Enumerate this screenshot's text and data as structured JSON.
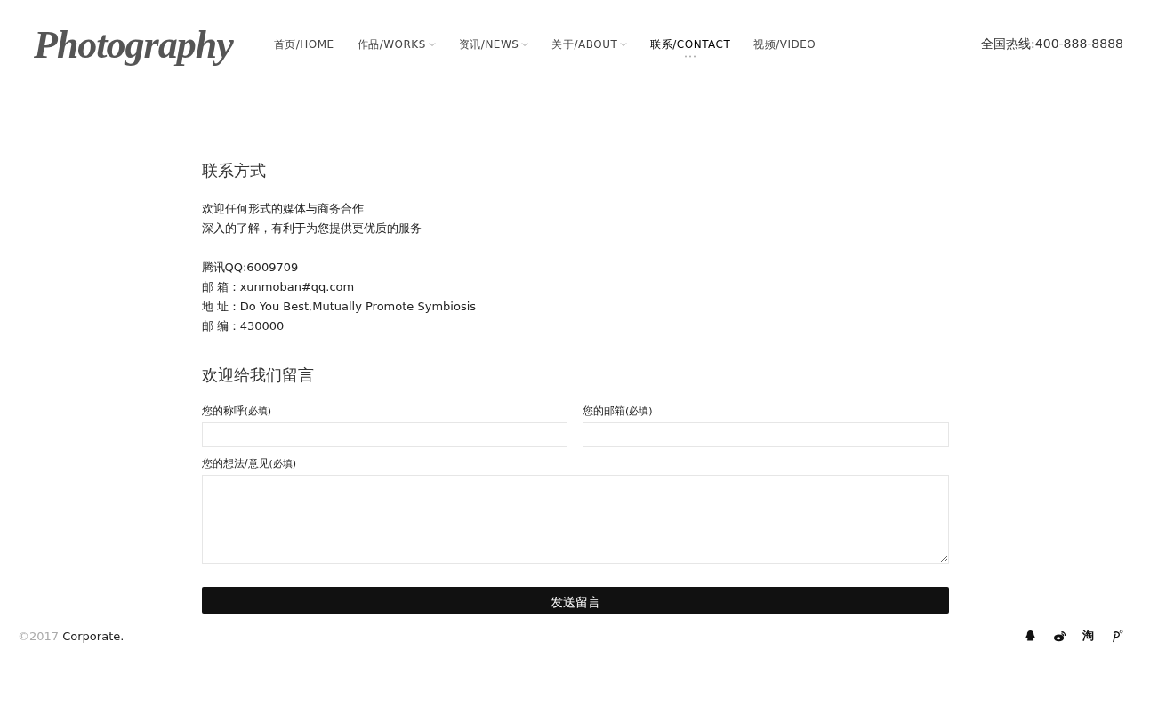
{
  "logo": "Photography",
  "nav": [
    {
      "label": "首页/HOME",
      "has_dropdown": false,
      "selected": false
    },
    {
      "label": "作品/WORKS",
      "has_dropdown": true,
      "selected": false
    },
    {
      "label": "资讯/NEWS",
      "has_dropdown": true,
      "selected": false
    },
    {
      "label": "关于/ABOUT",
      "has_dropdown": true,
      "selected": false
    },
    {
      "label": "联系/CONTACT",
      "has_dropdown": false,
      "selected": true
    },
    {
      "label": "视频/VIDEO",
      "has_dropdown": false,
      "selected": false
    }
  ],
  "hotline": "全国热线:400-888-8888",
  "contact": {
    "title": "联系方式",
    "intro": [
      "欢迎任何形式的媒体与商务合作",
      "深入的了解，有利于为您提供更优质的服务"
    ],
    "details": [
      "腾讯QQ:6009709",
      "邮 箱：xunmoban#qq.com",
      "地 址：Do You Best,Mutually Promote Symbiosis",
      "邮 编：430000"
    ]
  },
  "form": {
    "title": "欢迎给我们留言",
    "fields": [
      {
        "kind": "input",
        "label": "您的称呼",
        "note": "(必填)"
      },
      {
        "kind": "input",
        "label": "您的邮箱",
        "note": "(必填)"
      },
      {
        "kind": "textarea",
        "label": "您的想法/意见",
        "note": "(必填)"
      }
    ],
    "submit": "发送留言"
  },
  "footer": {
    "year": "©2017",
    "company": "Corporate.",
    "social": [
      {
        "kind": "qq"
      },
      {
        "kind": "weibo"
      },
      {
        "kind": "text",
        "glyph": "淘"
      },
      {
        "kind": "pinterest"
      }
    ]
  }
}
